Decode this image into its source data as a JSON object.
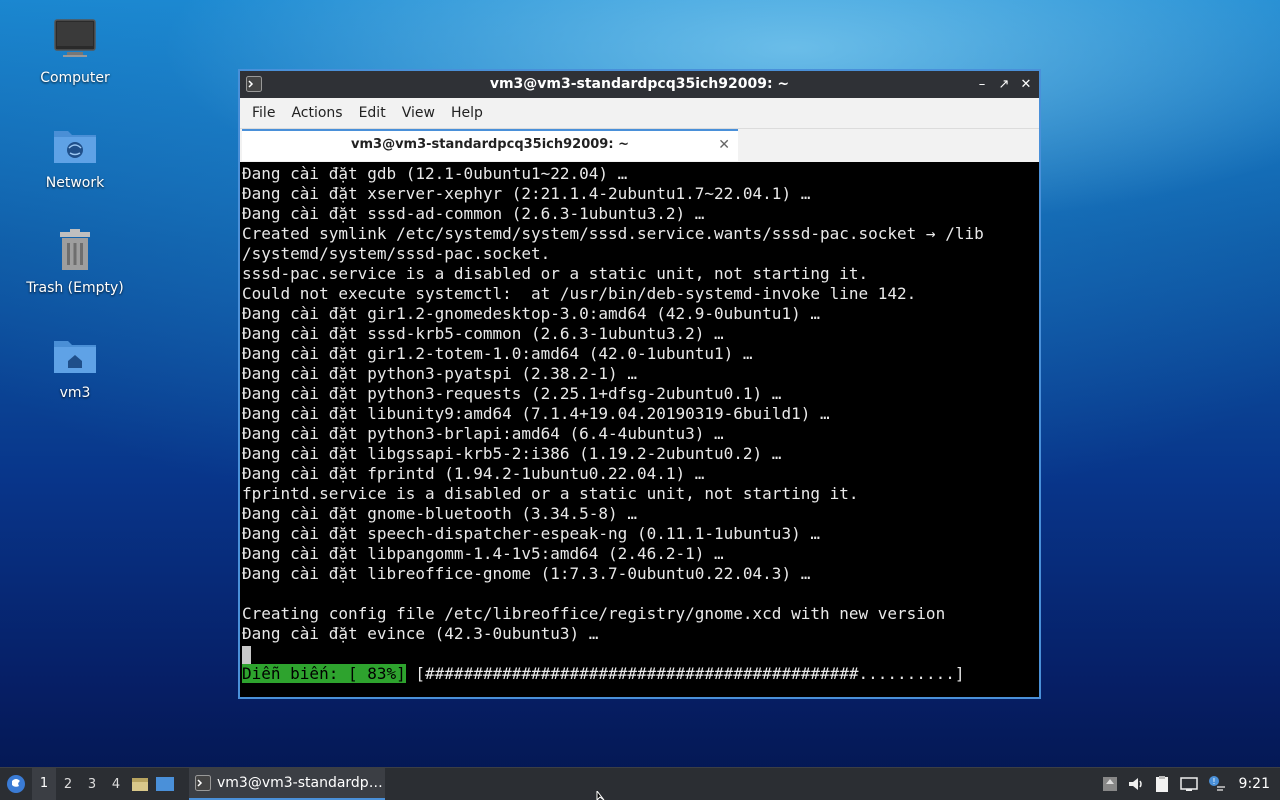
{
  "desktop": {
    "icons": [
      {
        "label": "Computer"
      },
      {
        "label": "Network"
      },
      {
        "label": "Trash (Empty)"
      },
      {
        "label": "vm3"
      }
    ]
  },
  "window": {
    "title": "vm3@vm3-standardpcq35ich92009: ~",
    "menu": [
      "File",
      "Actions",
      "Edit",
      "View",
      "Help"
    ],
    "tab_label": "vm3@vm3-standardpcq35ich92009: ~",
    "terminal_lines": [
      "Đang cài đặt gdb (12.1-0ubuntu1~22.04) …",
      "Đang cài đặt xserver-xephyr (2:21.1.4-2ubuntu1.7~22.04.1) …",
      "Đang cài đặt sssd-ad-common (2.6.3-1ubuntu3.2) …",
      "Created symlink /etc/systemd/system/sssd.service.wants/sssd-pac.socket → /lib",
      "/systemd/system/sssd-pac.socket.",
      "sssd-pac.service is a disabled or a static unit, not starting it.",
      "Could not execute systemctl:  at /usr/bin/deb-systemd-invoke line 142.",
      "Đang cài đặt gir1.2-gnomedesktop-3.0:amd64 (42.9-0ubuntu1) …",
      "Đang cài đặt sssd-krb5-common (2.6.3-1ubuntu3.2) …",
      "Đang cài đặt gir1.2-totem-1.0:amd64 (42.0-1ubuntu1) …",
      "Đang cài đặt python3-pyatspi (2.38.2-1) …",
      "Đang cài đặt python3-requests (2.25.1+dfsg-2ubuntu0.1) …",
      "Đang cài đặt libunity9:amd64 (7.1.4+19.04.20190319-6build1) …",
      "Đang cài đặt python3-brlapi:amd64 (6.4-4ubuntu3) …",
      "Đang cài đặt libgssapi-krb5-2:i386 (1.19.2-2ubuntu0.2) …",
      "Đang cài đặt fprintd (1.94.2-1ubuntu0.22.04.1) …",
      "fprintd.service is a disabled or a static unit, not starting it.",
      "Đang cài đặt gnome-bluetooth (3.34.5-8) …",
      "Đang cài đặt speech-dispatcher-espeak-ng (0.11.1-1ubuntu3) …",
      "Đang cài đặt libpangomm-1.4-1v5:amd64 (2.46.2-1) …",
      "Đang cài đặt libreoffice-gnome (1:7.3.7-0ubuntu0.22.04.3) …",
      "",
      "Creating config file /etc/libreoffice/registry/gnome.xcd with new version",
      "Đang cài đặt evince (42.3-0ubuntu3) …"
    ],
    "progress_label": "Diễn biến: [ 83%]",
    "progress_bar": " [#############################################..........]"
  },
  "taskbar": {
    "workspaces": [
      "1",
      "2",
      "3",
      "4"
    ],
    "task_label": "vm3@vm3-standardp…",
    "clock": "9:21"
  },
  "colors": {
    "accent": "#4a90d9",
    "progress_bg": "#2ea32e",
    "terminal_bg": "#000000"
  }
}
